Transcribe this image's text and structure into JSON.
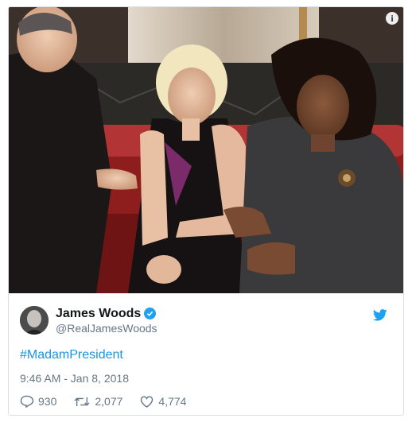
{
  "tweet": {
    "author": {
      "name": "James Woods",
      "handle": "@RealJamesWoods"
    },
    "hashtag": "#MadamPresident",
    "timestamp": "9:46 AM - Jan 8, 2018",
    "stats": {
      "replies": "930",
      "retweets": "2,077",
      "likes": "4,774"
    }
  },
  "colors": {
    "accent": "#1da1f2",
    "link": "#1b95e0",
    "secondary_text": "#657786",
    "primary_text": "#14171a",
    "border": "#d8dfe4"
  },
  "icons": {
    "info": "info-icon",
    "verified": "verified-badge-icon",
    "brand": "twitter-bird-icon",
    "reply": "reply-icon",
    "retweet": "retweet-icon",
    "like": "heart-icon"
  }
}
